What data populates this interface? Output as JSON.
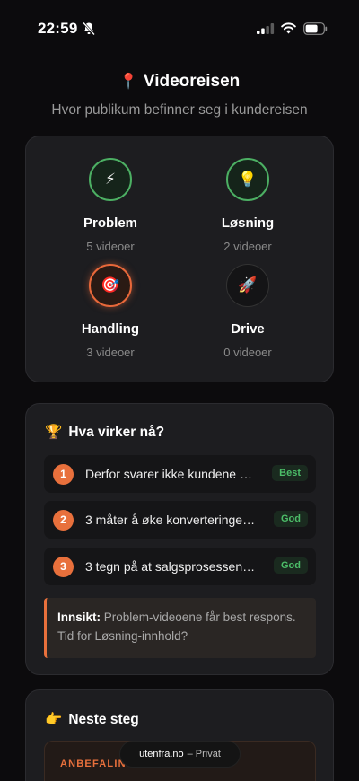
{
  "status_bar": {
    "time": "22:59"
  },
  "header": {
    "pin_icon": "📍",
    "title": "Videoreisen",
    "subtitle": "Hvor publikum befinner seg i kundereisen"
  },
  "journey": {
    "stages": [
      {
        "icon": "⚡",
        "icon_name": "lightning-icon",
        "name": "Problem",
        "count": "5 videoer",
        "state": "active"
      },
      {
        "icon": "💡",
        "icon_name": "lightbulb-icon",
        "name": "Løsning",
        "count": "2 videoer",
        "state": "active"
      },
      {
        "icon": "🎯",
        "icon_name": "target-icon",
        "name": "Handling",
        "count": "3 videoer",
        "state": "highlight"
      },
      {
        "icon": "🚀",
        "icon_name": "rocket-icon",
        "name": "Drive",
        "count": "0 videoer",
        "state": "empty"
      }
    ]
  },
  "works": {
    "icon": "🏆",
    "title": "Hva virker nå?",
    "items": [
      {
        "rank": "1",
        "text": "Derfor svarer ikke kundene …",
        "badge": "Best"
      },
      {
        "rank": "2",
        "text": "3 måter å øke konverteringe…",
        "badge": "God"
      },
      {
        "rank": "3",
        "text": "3 tegn på at salgsprosessen…",
        "badge": "God"
      }
    ],
    "insight_label": "Innsikt:",
    "insight_text": " Problem-videoene får best respons. Tid for Løsning-innhold?"
  },
  "next": {
    "icon": "👉",
    "title": "Neste steg",
    "reco_label": "ANBEFALING"
  },
  "toast": {
    "domain": "utenfra.no",
    "suffix": "– Privat"
  },
  "colors": {
    "accent": "#e8703c",
    "success": "#4caf63",
    "background": "#0c0b0d",
    "card": "#1d1d20"
  }
}
